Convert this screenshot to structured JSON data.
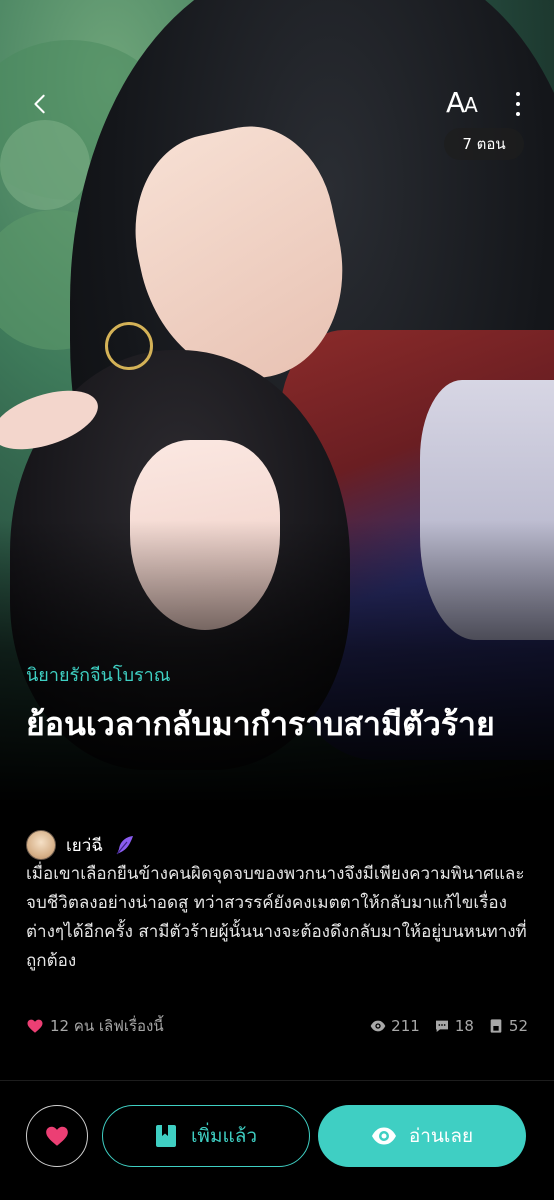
{
  "header": {
    "font_size_label_big": "A",
    "font_size_label_small": "A",
    "episodes_badge": "7 ตอน"
  },
  "novel": {
    "genre": "นิยายรักจีนโบราณ",
    "title": "ย้อนเวลากลับมากำราบสามีตัวร้าย",
    "author": "เยว่ฉี",
    "synopsis": "เมื่อเขาเลือกยืนข้างคนผิดจุดจบของพวกนางจึงมีเพียงความพินาศและจบชีวิตลงอย่างน่าอดสู ทว่าสวรรค์ยังคงเมตตาให้กลับมาแก้ไขเรื่องต่างๆได้อีกครั้ง สามีตัวร้ายผู้นั้นนางจะต้องดึงกลับมาให้อยู่บนหนทางที่ถูกต้อง"
  },
  "stats": {
    "likes_text": "12 คน เลิฟเรื่องนี้",
    "views": "211",
    "comments": "18",
    "chapters": "52"
  },
  "actions": {
    "added_label": "เพิ่มแล้ว",
    "read_label": "อ่านเลย"
  },
  "colors": {
    "accent": "#3fcfc3",
    "heart": "#ec3f74",
    "background": "#000000"
  },
  "icons": [
    "back-chevron-icon",
    "more-vertical-icon",
    "feather-icon",
    "heart-icon",
    "eye-icon",
    "comment-icon",
    "book-icon"
  ]
}
